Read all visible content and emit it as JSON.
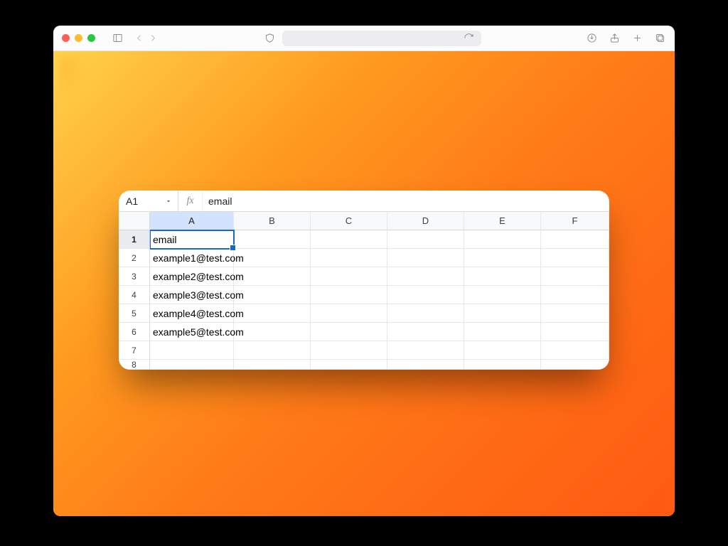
{
  "browser": {
    "traffic": {
      "close": "close",
      "min": "minimize",
      "max": "maximize"
    }
  },
  "sheet": {
    "name_box": "A1",
    "fx_label": "fx",
    "formula_value": "email",
    "columns": [
      "A",
      "B",
      "C",
      "D",
      "E",
      "F"
    ],
    "row_numbers": [
      "1",
      "2",
      "3",
      "4",
      "5",
      "6",
      "7",
      "8"
    ],
    "active_cell": {
      "row": 0,
      "col": 0
    },
    "data": [
      [
        "email",
        "",
        "",
        "",
        "",
        ""
      ],
      [
        "example1@test.com",
        "",
        "",
        "",
        "",
        ""
      ],
      [
        "example2@test.com",
        "",
        "",
        "",
        "",
        ""
      ],
      [
        "example3@test.com",
        "",
        "",
        "",
        "",
        ""
      ],
      [
        "example4@test.com",
        "",
        "",
        "",
        "",
        ""
      ],
      [
        "example5@test.com",
        "",
        "",
        "",
        "",
        ""
      ],
      [
        "",
        "",
        "",
        "",
        "",
        ""
      ],
      [
        "",
        "",
        "",
        "",
        "",
        ""
      ]
    ]
  }
}
